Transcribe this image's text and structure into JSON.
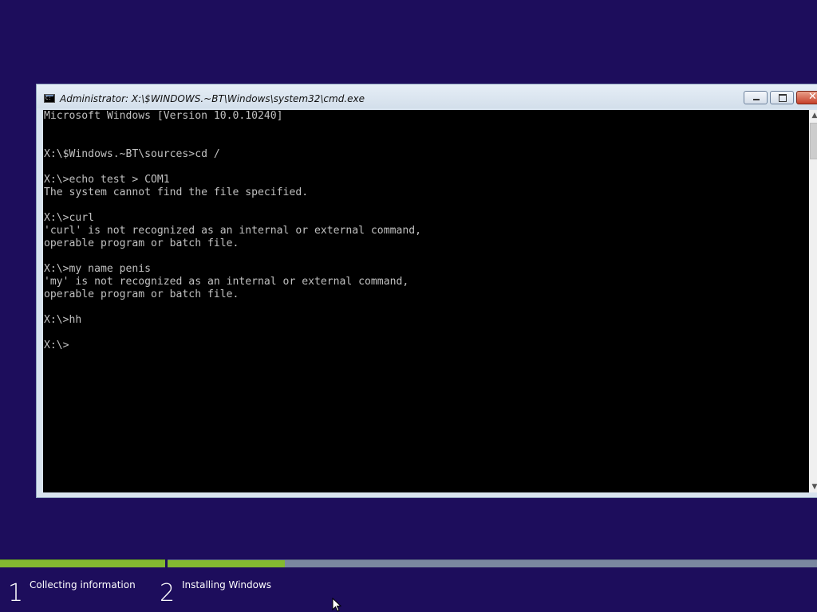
{
  "window": {
    "title": "Administrator: X:\\$WINDOWS.~BT\\Windows\\system32\\cmd.exe",
    "icon": "cmd-icon",
    "controls": {
      "minimize": "minimize-icon",
      "maximize": "maximize-icon",
      "close": "✕"
    }
  },
  "console": {
    "text": "Microsoft Windows [Version 10.0.10240]\n\n\nX:\\$Windows.~BT\\sources>cd /\n\nX:\\>echo test > COM1\nThe system cannot find the file specified.\n\nX:\\>curl\n'curl' is not recognized as an internal or external command,\noperable program or batch file.\n\nX:\\>my name penis\n'my' is not recognized as an internal or external command,\noperable program or batch file.\n\nX:\\>hh\n\nX:\\>"
  },
  "setup": {
    "steps": [
      {
        "number": "1",
        "label": "Collecting information",
        "progress": 1.0
      },
      {
        "number": "2",
        "label": "Installing Windows",
        "progress": 0.18
      }
    ],
    "colors": {
      "background": "#1d0d5c",
      "progress_fill": "#83b930",
      "progress_track": "#7a87a0"
    }
  }
}
